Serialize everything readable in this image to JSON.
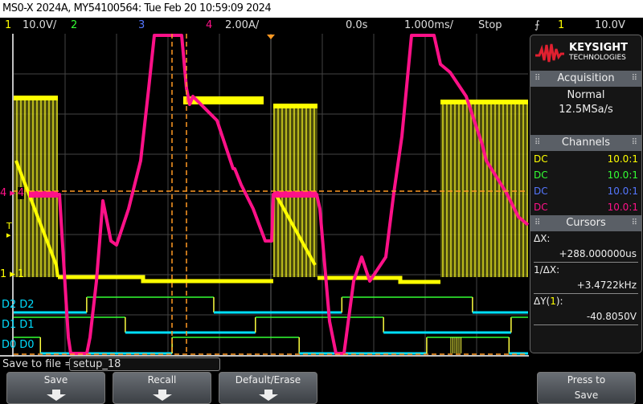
{
  "title": "MS0-X 2024A, MY54100564: Tue Feb 20 10:59:09 2024",
  "status": {
    "ch1": "1",
    "ch1_scale": "10.0V/",
    "ch2": "2",
    "ch3": "3",
    "ch4": "4",
    "ch4_scale": "2.00A/",
    "delay": "0.0s",
    "timebase": "1.000ms/",
    "run_state": "Stop",
    "trigger_source": "1",
    "trigger_level": "10.0V"
  },
  "colors": {
    "ch1": "#ffff00",
    "ch2": "#33ff33",
    "ch3": "#5577ff",
    "ch4": "#ff1188",
    "digital": "#00e0ff",
    "cursor": "#ff9922"
  },
  "brand": {
    "name": "KEYSIGHT",
    "sub": "TECHNOLOGIES"
  },
  "acquisition": {
    "header": "Acquisition",
    "mode": "Normal",
    "rate": "12.5MSa/s"
  },
  "channels": {
    "header": "Channels",
    "rows": [
      {
        "coupling": "DC",
        "probe": "10.0:1"
      },
      {
        "coupling": "DC",
        "probe": "10.0:1"
      },
      {
        "coupling": "DC",
        "probe": "10.0:1"
      },
      {
        "coupling": "DC",
        "probe": "10.0:1"
      }
    ]
  },
  "cursors": {
    "header": "Cursors",
    "dx_label": "ΔX:",
    "dx": "+288.000000us",
    "inv_label": "1/ΔX:",
    "inv": "+3.4722kHz",
    "dy_label_pre": "ΔY(",
    "dy_ch": "1",
    "dy_label_post": "):",
    "dy": "-40.8050V"
  },
  "markers": {
    "ch4": "4",
    "ch1": "1",
    "trigger": "T",
    "d2": "D2",
    "d1": "D1",
    "d0": "D0"
  },
  "digital": {
    "time_unit": "ms",
    "channels": [
      {
        "name": "D2",
        "initial": 0,
        "edges": [
          -3.58,
          -1.11,
          1.38,
          3.92
        ]
      },
      {
        "name": "D1",
        "initial": 1,
        "edges": [
          -2.83,
          -0.3,
          2.19,
          4.67
        ]
      },
      {
        "name": "D0",
        "initial": 1,
        "edges": [
          -4.48,
          -1.92,
          0.55,
          3.03,
          4.63
        ]
      }
    ]
  },
  "save": {
    "label": "Save to file =",
    "filename": "setup_18"
  },
  "softkeys": [
    "Save",
    "Recall",
    "Default/Erase",
    "Press to Save"
  ]
}
